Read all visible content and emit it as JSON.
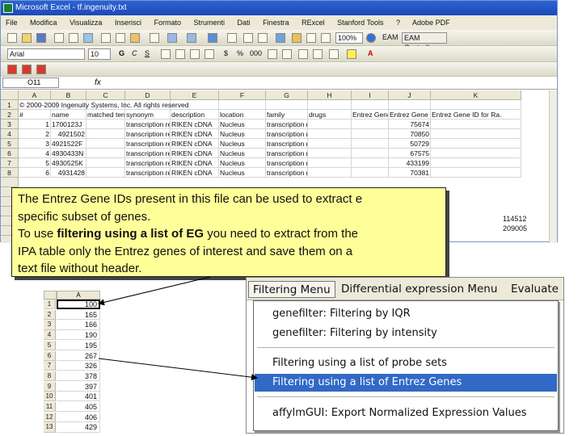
{
  "excel": {
    "title": "Microsoft Excel - tf.ingenuity.txt",
    "menus": [
      "File",
      "Modifica",
      "Visualizza",
      "Inserisci",
      "Formato",
      "Strumenti",
      "Dati",
      "Finestra",
      "RExcel",
      "Stanford Tools",
      "?",
      "Adobe PDF"
    ],
    "zoom": "100%",
    "eam_label": "EAM Controller",
    "font_name": "Arial",
    "font_size": "10",
    "name_box": "O11",
    "fx": "fx",
    "columns": [
      "A",
      "B",
      "C",
      "D",
      "E",
      "F",
      "G",
      "H",
      "I",
      "J",
      "K"
    ],
    "rows": [
      {
        "n": "1",
        "cells": [
          "© 2000-2009 Ingenuity Systems, Inc. All rights reserved",
          "",
          "",
          "",
          "",
          "",
          "",
          "",
          "",
          "",
          ""
        ]
      },
      {
        "n": "2",
        "cells": [
          "#",
          "name",
          "matched term",
          "synonym",
          "description",
          "location",
          "family",
          "drugs",
          "Entrez Gene",
          "Entrez Gene",
          "Entrez Gene ID for Ra."
        ]
      },
      {
        "n": "3",
        "cells": [
          "1",
          "1700123J",
          "",
          "transcription regulator",
          "RIKEN cDNA",
          "Nucleus",
          "transcription regulator",
          "",
          "",
          "75674",
          ""
        ]
      },
      {
        "n": "4",
        "cells": [
          "2",
          "4921502",
          "",
          "transcription regulator",
          "RIKEN cDNA",
          "Nucleus",
          "transcription regulator",
          "",
          "",
          "70850",
          ""
        ]
      },
      {
        "n": "5",
        "cells": [
          "3",
          "4921522F",
          "",
          "transcription regulator",
          "RIKEN cDNA",
          "Nucleus",
          "transcription regulator",
          "",
          "",
          "50729",
          ""
        ]
      },
      {
        "n": "6",
        "cells": [
          "4",
          "4930433N",
          "",
          "transcription regulator",
          "RIKEN cDNA",
          "Nucleus",
          "transcription regulator",
          "",
          "",
          "67575",
          ""
        ]
      },
      {
        "n": "7",
        "cells": [
          "5",
          "4930525K",
          "",
          "transcription regulator",
          "RIKEN cDNA",
          "Nucleus",
          "transcription regulator",
          "",
          "",
          "433199",
          ""
        ]
      },
      {
        "n": "8",
        "cells": [
          "6",
          "4931428",
          "",
          "transcription regulator",
          "RIKEN cDNA",
          "Nucleus",
          "transcription regulator",
          "",
          "",
          "70381",
          ""
        ]
      }
    ],
    "right_values": [
      "114512",
      "209005"
    ]
  },
  "callout": {
    "line1": "The Entrez Gene IDs present in this file can be used to extract e",
    "line2": "specific subset of genes.",
    "line3_pre": "To use ",
    "line3_bold": "filtering using a list of EG",
    "line3_post": " you need to extract from the",
    "line4": "IPA table only the Entrez genes of interest and save them on a",
    "line5": "text file without header."
  },
  "minisheet": {
    "column": "A",
    "rows": [
      {
        "n": "1",
        "v": "100"
      },
      {
        "n": "2",
        "v": "165"
      },
      {
        "n": "3",
        "v": "166"
      },
      {
        "n": "4",
        "v": "190"
      },
      {
        "n": "5",
        "v": "195"
      },
      {
        "n": "6",
        "v": "267"
      },
      {
        "n": "7",
        "v": "326"
      },
      {
        "n": "8",
        "v": "378"
      },
      {
        "n": "9",
        "v": "397"
      },
      {
        "n": "10",
        "v": "401"
      },
      {
        "n": "11",
        "v": "405"
      },
      {
        "n": "12",
        "v": "406"
      },
      {
        "n": "13",
        "v": "429"
      }
    ]
  },
  "menuapp": {
    "menus": [
      "Filtering Menu",
      "Differential expression Menu",
      "Evaluate"
    ],
    "items": [
      "genefilter: Filtering by IQR",
      "genefilter: Filtering by intensity",
      "Filtering using a list of probe sets",
      "Filtering using a list of Entrez Genes",
      "affylmGUI: Export Normalized Expression Values"
    ],
    "selected_index": 3
  },
  "colors": {
    "callout_bg": "#ffff99",
    "selected_item": "#3169c6",
    "title_bar": "#2c63d4"
  }
}
